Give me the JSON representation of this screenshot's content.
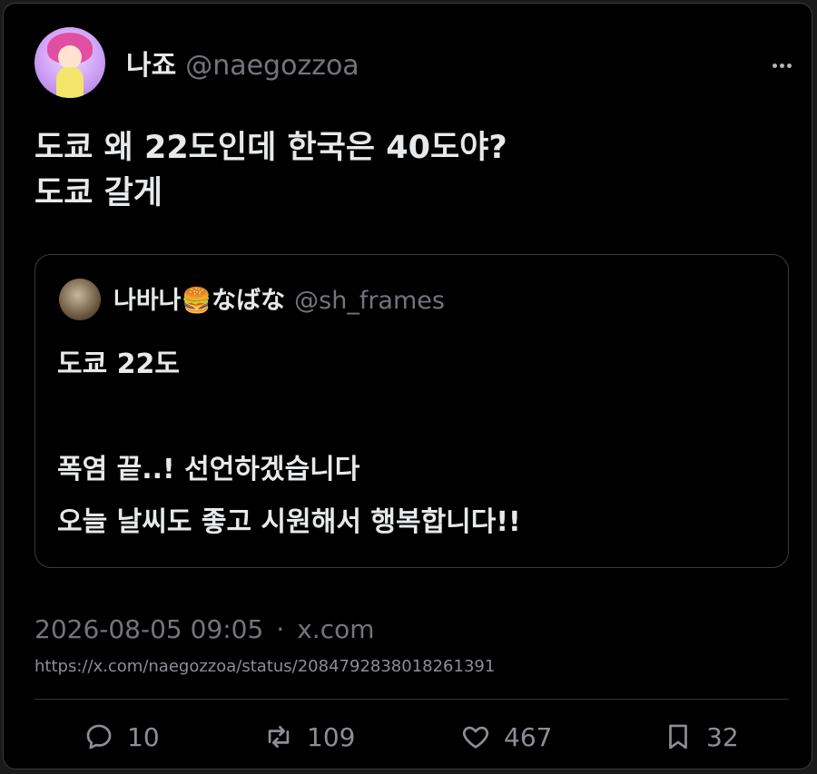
{
  "author": {
    "display_name": "나죠",
    "handle": "@naegozzoa"
  },
  "tweet": {
    "lines": "도쿄 왜 22도인데 한국은 40도야?\n도쿄 갈게"
  },
  "quote": {
    "display_name": "나바나🍔なばな",
    "handle": "@sh_frames",
    "lines": "도쿄 22도\n\n폭염 끝..! 선언하겠습니다\n오늘 날씨도 좋고 시원해서 행복합니다!!"
  },
  "meta": {
    "datetime": "2026-08-05 09:05",
    "separator": "·",
    "source": "x.com",
    "url": "https://x.com/naegozzoa/status/2084792838018261391"
  },
  "actions": {
    "replies": "10",
    "retweets": "109",
    "likes": "467",
    "bookmarks": "32"
  },
  "icons": {
    "more": "more-horizontal-icon",
    "reply": "reply-icon",
    "retweet": "retweet-icon",
    "like": "heart-icon",
    "bookmark": "bookmark-icon"
  },
  "colors": {
    "background": "#000000",
    "text": "#e7e9ea",
    "muted": "#71767b",
    "border": "#3a3a3a"
  }
}
